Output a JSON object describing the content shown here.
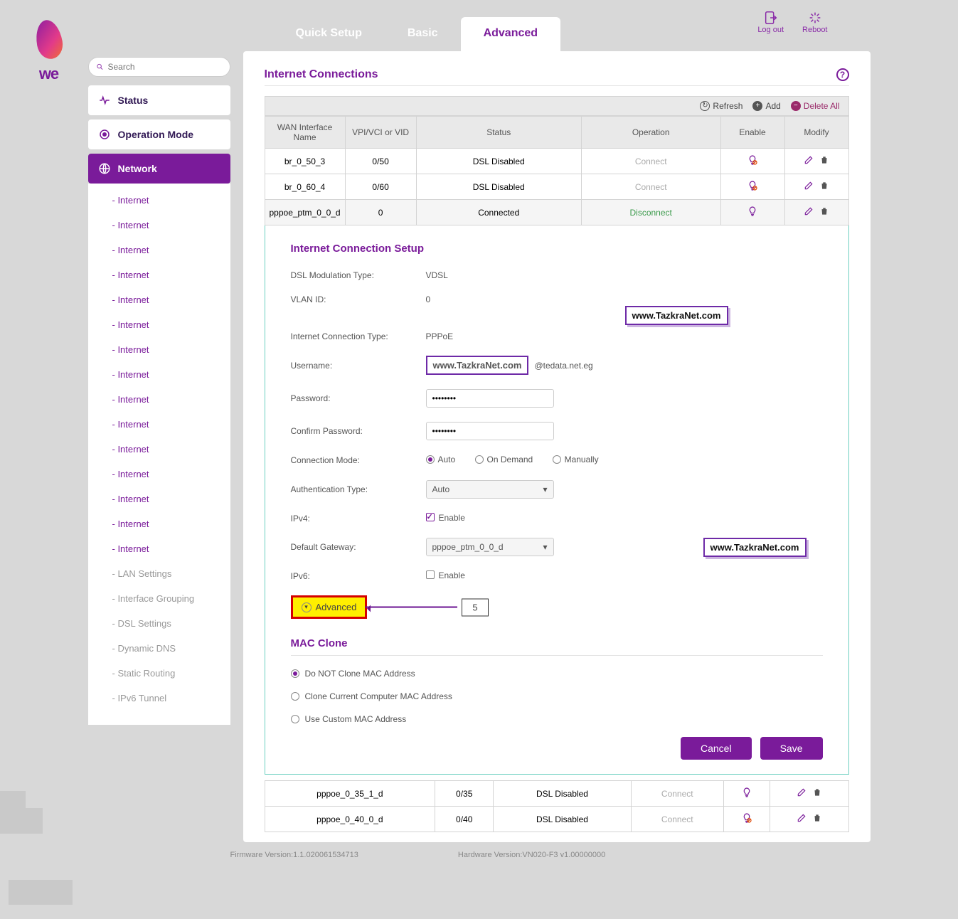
{
  "brand": "we",
  "tabs": {
    "quick": "Quick Setup",
    "basic": "Basic",
    "advanced": "Advanced"
  },
  "top": {
    "logout": "Log out",
    "reboot": "Reboot"
  },
  "search": {
    "placeholder": "Search"
  },
  "side": {
    "status": "Status",
    "opmode": "Operation Mode",
    "network": "Network",
    "subs": [
      "- Internet",
      "- Internet",
      "- Internet",
      "- Internet",
      "- Internet",
      "- Internet",
      "- Internet",
      "- Internet",
      "- Internet",
      "- Internet",
      "- Internet",
      "- Internet",
      "- Internet",
      "- Internet",
      "- Internet"
    ],
    "mute": [
      "- LAN Settings",
      "- Interface Grouping",
      "- DSL Settings",
      "- Dynamic DNS",
      "- Static Routing",
      "- IPv6 Tunnel"
    ]
  },
  "heading": "Internet Connections",
  "toolbar": {
    "refresh": "Refresh",
    "add": "Add",
    "delall": "Delete All"
  },
  "cols": {
    "c1": "WAN Interface Name",
    "c2": "VPI/VCI or VID",
    "c3": "Status",
    "c4": "Operation",
    "c5": "Enable",
    "c6": "Modify"
  },
  "rows": [
    {
      "name": "br_0_50_3",
      "vpi": "0/50",
      "status": "DSL Disabled",
      "op": "Connect",
      "enabled": false
    },
    {
      "name": "br_0_60_4",
      "vpi": "0/60",
      "status": "DSL Disabled",
      "op": "Connect",
      "enabled": false
    },
    {
      "name": "pppoe_ptm_0_0_d",
      "vpi": "0",
      "status": "Connected",
      "op": "Disconnect",
      "enabled": true,
      "selected": true
    }
  ],
  "rows_after": [
    {
      "name": "pppoe_0_35_1_d",
      "vpi": "0/35",
      "status": "DSL Disabled",
      "op": "Connect",
      "enabled": true
    },
    {
      "name": "pppoe_0_40_0_d",
      "vpi": "0/40",
      "status": "DSL Disabled",
      "op": "Connect",
      "enabled": false
    }
  ],
  "setup": {
    "title": "Internet Connection Setup",
    "dsl_k": "DSL Modulation Type:",
    "dsl_v": "VDSL",
    "vlan_k": "VLAN ID:",
    "vlan_v": "0",
    "ict_k": "Internet Connection Type:",
    "ict_v": "PPPoE",
    "user_k": "Username:",
    "user_suffix": "@tedata.net.eg",
    "pw_k": "Password:",
    "pw_v": "••••••••",
    "cpw_k": "Confirm Password:",
    "cpw_v": "••••••••",
    "cm_k": "Connection Mode:",
    "cm_auto": "Auto",
    "cm_ond": "On Demand",
    "cm_man": "Manually",
    "auth_k": "Authentication Type:",
    "auth_v": "Auto",
    "ipv4_k": "IPv4:",
    "ipv4_en": "Enable",
    "gw_k": "Default Gateway:",
    "gw_v": "pppoe_ptm_0_0_d",
    "ipv6_k": "IPv6:",
    "ipv6_en": "Enable",
    "adv_label": "Advanced",
    "annot_num": "5"
  },
  "mac": {
    "title": "MAC Clone",
    "opt1": "Do NOT Clone MAC Address",
    "opt2": "Clone Current Computer MAC Address",
    "opt3": "Use Custom MAC Address"
  },
  "btn": {
    "cancel": "Cancel",
    "save": "Save"
  },
  "wm": "www.TazkraNet.com",
  "fw": "Firmware Version:1.1.020061534713",
  "hw": "Hardware Version:VN020-F3 v1.00000000"
}
